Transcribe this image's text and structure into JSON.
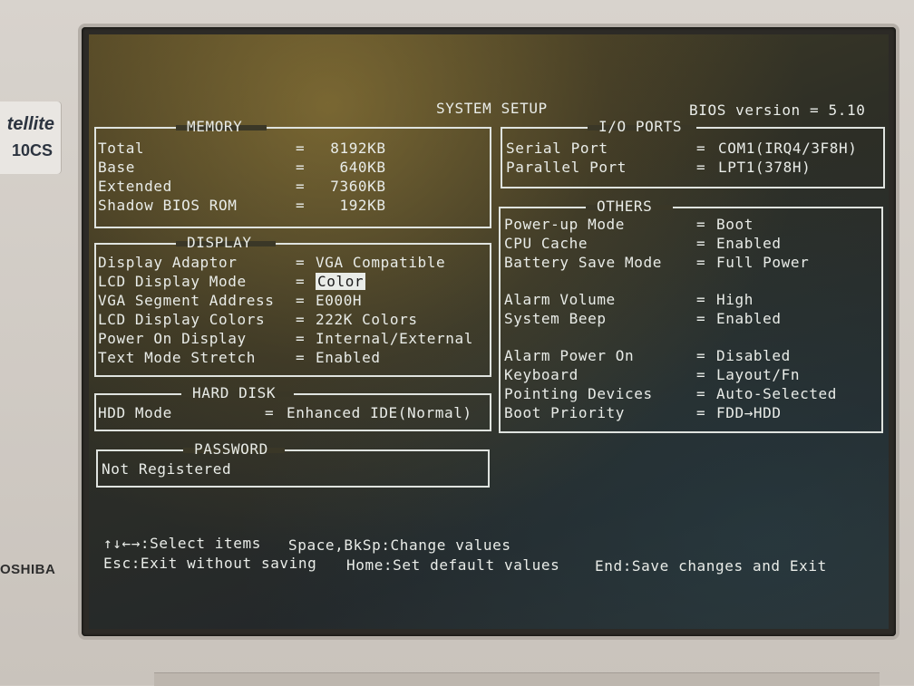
{
  "bezel": {
    "logo_line1": "tellite",
    "logo_line2": "10CS",
    "brand": "OSHIBA"
  },
  "header": {
    "title": "SYSTEM SETUP",
    "bios_version": "BIOS version = 5.10"
  },
  "memory": {
    "title": "MEMORY",
    "rows": [
      {
        "label": "Total",
        "sep": "=",
        "value": " 8192KB"
      },
      {
        "label": "Base",
        "sep": "=",
        "value": "  640KB"
      },
      {
        "label": "Extended",
        "sep": "=",
        "value": " 7360KB"
      },
      {
        "label": "Shadow BIOS ROM",
        "sep": "=",
        "value": "  192KB"
      }
    ]
  },
  "display": {
    "title": "DISPLAY",
    "rows": [
      {
        "label": "Display Adaptor",
        "sep": "=",
        "value": "VGA Compatible"
      },
      {
        "label": "LCD Display Mode",
        "sep": "=",
        "value": "Color"
      },
      {
        "label": "VGA Segment Address",
        "sep": "=",
        "value": "E000H"
      },
      {
        "label": "LCD Display Colors",
        "sep": "=",
        "value": "222K Colors"
      },
      {
        "label": "Power On Display",
        "sep": "=",
        "value": "Internal/External"
      },
      {
        "label": "Text Mode Stretch",
        "sep": "=",
        "value": "Enabled"
      }
    ]
  },
  "hard_disk": {
    "title": "HARD DISK",
    "rows": [
      {
        "label": "HDD Mode",
        "sep": "=",
        "value": "Enhanced IDE(Normal)"
      }
    ]
  },
  "password": {
    "title": "PASSWORD",
    "value": "Not Registered"
  },
  "io_ports": {
    "title": "I/O PORTS",
    "rows": [
      {
        "label": "Serial Port",
        "sep": "=",
        "value": "COM1(IRQ4/3F8H)"
      },
      {
        "label": "Parallel Port",
        "sep": "=",
        "value": "LPT1(378H)"
      }
    ]
  },
  "others": {
    "title": "OTHERS",
    "rows": [
      {
        "label": "Power-up Mode",
        "sep": "=",
        "value": "Boot"
      },
      {
        "label": "CPU Cache",
        "sep": "=",
        "value": "Enabled"
      },
      {
        "label": "Battery Save Mode",
        "sep": "=",
        "value": "Full Power"
      },
      {
        "label": "Alarm Volume",
        "sep": "=",
        "value": "High"
      },
      {
        "label": "System Beep",
        "sep": "=",
        "value": "Enabled"
      },
      {
        "label": "Alarm Power On",
        "sep": "=",
        "value": "Disabled"
      },
      {
        "label": "Keyboard",
        "sep": "=",
        "value": "Layout/Fn"
      },
      {
        "label": "Pointing Devices",
        "sep": "=",
        "value": "Auto-Selected"
      },
      {
        "label": "Boot Priority",
        "sep": "=",
        "value": "FDD→HDD"
      }
    ]
  },
  "help": {
    "line1_a": "↑↓←→:Select items",
    "line1_b": "Space,BkSp:Change values",
    "line2_a": "Esc:Exit without saving",
    "line2_b": "Home:Set default values",
    "line2_c": "End:Save changes and Exit"
  }
}
